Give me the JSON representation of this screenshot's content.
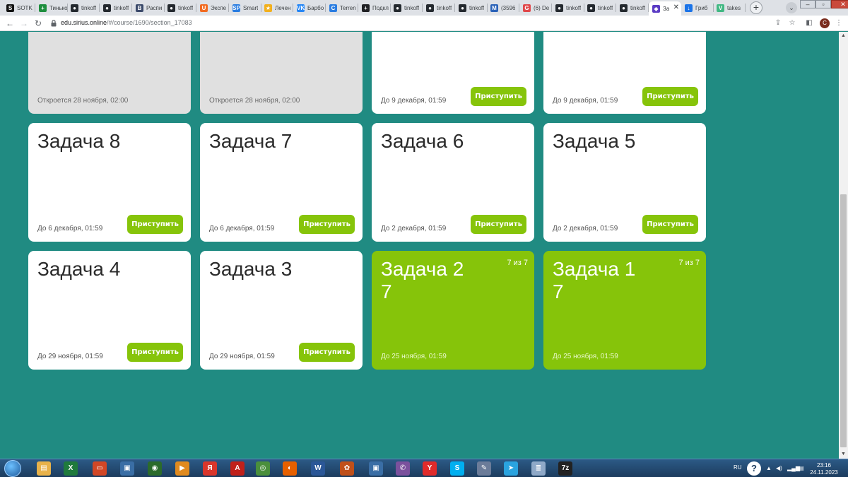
{
  "browser": {
    "tabs": [
      {
        "label": "SOTK",
        "icon": "sotka-icon",
        "color": "#111111",
        "glyph": "S"
      },
      {
        "label": "Тинько",
        "icon": "tinkoff-sheet-icon",
        "color": "#1e8e3e",
        "glyph": "+"
      },
      {
        "label": "tinkoff",
        "icon": "github-icon",
        "color": "#24292f",
        "glyph": "●"
      },
      {
        "label": "tinkoff",
        "icon": "github-icon",
        "color": "#24292f",
        "glyph": "●"
      },
      {
        "label": "Распи",
        "icon": "bookmark-b-icon",
        "color": "#3b4a6b",
        "glyph": "B"
      },
      {
        "label": "tinkoff",
        "icon": "github-icon",
        "color": "#24292f",
        "glyph": "●"
      },
      {
        "label": "Экспе",
        "icon": "orange-doc-icon",
        "color": "#f26b21",
        "glyph": "U"
      },
      {
        "label": "Smart",
        "icon": "smart-icon",
        "color": "#2a7de1",
        "glyph": "SP"
      },
      {
        "label": "Лечен",
        "icon": "star-icon",
        "color": "#f2b01e",
        "glyph": "★"
      },
      {
        "label": "Барбо",
        "icon": "vk-icon",
        "color": "#2787f5",
        "glyph": "VK"
      },
      {
        "label": "Terren",
        "icon": "c-icon",
        "color": "#2a7de1",
        "glyph": "C"
      },
      {
        "label": "Подкл",
        "icon": "plus-circle-icon",
        "color": "#202124",
        "glyph": "+"
      },
      {
        "label": "tinkoff",
        "icon": "github-icon",
        "color": "#24292f",
        "glyph": "●"
      },
      {
        "label": "tinkoff",
        "icon": "github-icon",
        "color": "#24292f",
        "glyph": "●"
      },
      {
        "label": "tinkoff",
        "icon": "github-icon",
        "color": "#24292f",
        "glyph": "●"
      },
      {
        "label": "(3596",
        "icon": "mail-icon",
        "color": "#2a62b8",
        "glyph": "M"
      },
      {
        "label": "(6) De",
        "icon": "discussion-icon",
        "color": "#e0484b",
        "glyph": "G"
      },
      {
        "label": "tinkoff",
        "icon": "github-icon",
        "color": "#24292f",
        "glyph": "●"
      },
      {
        "label": "tinkoff",
        "icon": "github-icon",
        "color": "#24292f",
        "glyph": "●"
      },
      {
        "label": "tinkoff",
        "icon": "github-icon",
        "color": "#24292f",
        "glyph": "●"
      },
      {
        "label": "За",
        "icon": "sirius-shield-icon",
        "color": "#5b3cc4",
        "glyph": "◆",
        "active": true
      },
      {
        "label": "Гриб",
        "icon": "mushroom-icon",
        "color": "#1a73e8",
        "glyph": "↓"
      },
      {
        "label": "takes",
        "icon": "vue-icon",
        "color": "#41b883",
        "glyph": "V"
      }
    ],
    "new_tab": "+",
    "url_host": "edu.sirius.online",
    "url_path": "/#/course/1690/section_17083",
    "profile_initial": "С"
  },
  "cards": [
    {
      "state": "locked",
      "title": "",
      "date": "Откроется 28 ноября, 02:00"
    },
    {
      "state": "locked",
      "title": "",
      "date": "Откроется 28 ноября, 02:00"
    },
    {
      "state": "open",
      "title": "",
      "date": "До 9 декабря, 01:59",
      "button": "Приступить"
    },
    {
      "state": "open",
      "title": "",
      "date": "До 9 декабря, 01:59",
      "button": "Приступить"
    },
    {
      "state": "open",
      "title": "Задача 8",
      "date": "До 6 декабря, 01:59",
      "button": "Приступить"
    },
    {
      "state": "open",
      "title": "Задача 7",
      "date": "До 6 декабря, 01:59",
      "button": "Приступить"
    },
    {
      "state": "open",
      "title": "Задача 6",
      "date": "До 2 декабря, 01:59",
      "button": "Приступить"
    },
    {
      "state": "open",
      "title": "Задача 5",
      "date": "До 2 декабря, 01:59",
      "button": "Приступить"
    },
    {
      "state": "open",
      "title": "Задача 4",
      "date": "До 29 ноября, 01:59",
      "button": "Приступить"
    },
    {
      "state": "open",
      "title": "Задача 3",
      "date": "До 29 ноября, 01:59",
      "button": "Приступить"
    },
    {
      "state": "done",
      "title": "Задача 2",
      "score": "7",
      "progress": "7 из 7",
      "date": "До 25 ноября, 01:59"
    },
    {
      "state": "done",
      "title": "Задача 1",
      "score": "7",
      "progress": "7 из 7",
      "date": "До 25 ноября, 01:59"
    }
  ],
  "colors": {
    "page_bg": "#208b82",
    "accent_green": "#86c40a",
    "card_locked": "#e0e0e0"
  },
  "taskbar": {
    "apps": [
      {
        "name": "explorer-icon",
        "color": "#e8b24a",
        "glyph": "▤"
      },
      {
        "name": "excel-icon",
        "color": "#1f7a3c",
        "glyph": "X"
      },
      {
        "name": "presentation-icon",
        "color": "#d24726",
        "glyph": "▭"
      },
      {
        "name": "window-icon",
        "color": "#3a6ea5",
        "glyph": "▣"
      },
      {
        "name": "eye-app-icon",
        "color": "#2b6b2b",
        "glyph": "◉"
      },
      {
        "name": "media-player-icon",
        "color": "#e08a1e",
        "glyph": "▶"
      },
      {
        "name": "yandex-icon",
        "color": "#d9362b",
        "glyph": "Я"
      },
      {
        "name": "pdf-icon",
        "color": "#c0201a",
        "glyph": "A"
      },
      {
        "name": "chrome-icon",
        "color": "#4a8f3c",
        "glyph": "◎"
      },
      {
        "name": "firefox-icon",
        "color": "#e66000",
        "glyph": "◐"
      },
      {
        "name": "word-icon",
        "color": "#2b5797",
        "glyph": "W"
      },
      {
        "name": "film-reel-icon",
        "color": "#c0501a",
        "glyph": "✿"
      },
      {
        "name": "frame-icon",
        "color": "#3a6ea5",
        "glyph": "▣"
      },
      {
        "name": "viber-icon",
        "color": "#7b519d",
        "glyph": "✆"
      },
      {
        "name": "yandex-browser-icon",
        "color": "#e02b2b",
        "glyph": "Y"
      },
      {
        "name": "skype-icon",
        "color": "#00aff0",
        "glyph": "S"
      },
      {
        "name": "tools-icon",
        "color": "#6b7c99",
        "glyph": "✎"
      },
      {
        "name": "telegram-icon",
        "color": "#2aa3df",
        "glyph": "➤"
      },
      {
        "name": "notepad-icon",
        "color": "#8fa9c8",
        "glyph": "≣"
      },
      {
        "name": "7zip-icon",
        "color": "#222222",
        "glyph": "7z"
      }
    ],
    "language": "RU",
    "time": "23:16",
    "date": "24.11.2023"
  }
}
